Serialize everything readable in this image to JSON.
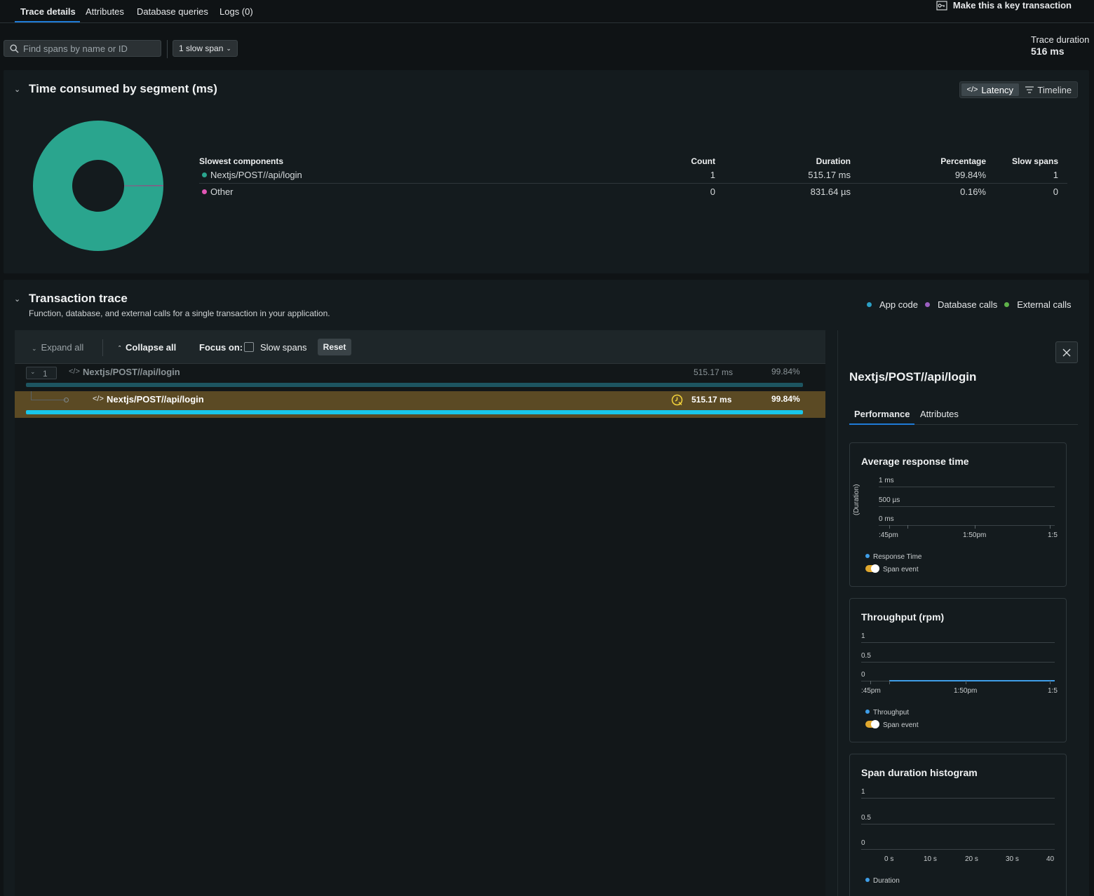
{
  "tabs": [
    {
      "label": "Trace details"
    },
    {
      "label": "Attributes"
    },
    {
      "label": "Database queries"
    },
    {
      "label": "Logs (0)"
    }
  ],
  "key_transaction_label": "Make this a key transaction",
  "search": {
    "placeholder": "Find spans by name or ID"
  },
  "slow_span_filter": "1 slow span",
  "trace_duration": {
    "label": "Trace duration",
    "value": "516 ms"
  },
  "segment": {
    "title": "Time consumed by segment (ms)",
    "toggle": {
      "latency": "Latency",
      "timeline": "Timeline"
    },
    "donut_percentages": [
      99.84,
      0.16
    ],
    "donut_colors": [
      "#2aa58e",
      "#cf4fae"
    ],
    "table": {
      "headers": {
        "component": "Slowest components",
        "count": "Count",
        "duration": "Duration",
        "percentage": "Percentage",
        "slow_spans": "Slow spans"
      },
      "rows": [
        {
          "name": "Nextjs/POST//api/login",
          "count": "1",
          "duration": "515.17 ms",
          "percentage": "99.84%",
          "slow_spans": "1",
          "color": "#2aa58e"
        },
        {
          "name": "Other",
          "count": "0",
          "duration": "831.64 µs",
          "percentage": "0.16%",
          "slow_spans": "0",
          "color": "#e056b4"
        }
      ]
    }
  },
  "transaction": {
    "title": "Transaction trace",
    "subtitle": "Function, database, and external calls for a single transaction in your application.",
    "legend": [
      {
        "label": "App code",
        "color": "#2b9fc4"
      },
      {
        "label": "Database calls",
        "color": "#9b5fc0"
      },
      {
        "label": "External calls",
        "color": "#5fb24a"
      }
    ],
    "toolbar": {
      "expand_all": "Expand all",
      "collapse_all": "Collapse all",
      "focus_on": "Focus on:",
      "slow_spans": "Slow spans",
      "reset": "Reset"
    },
    "rows": [
      {
        "count": "1",
        "name": "Nextjs/POST//api/login",
        "duration": "515.17 ms",
        "percentage": "99.84%"
      },
      {
        "name": "Nextjs/POST//api/login",
        "duration": "515.17 ms",
        "percentage": "99.84%"
      }
    ]
  },
  "side": {
    "title": "Nextjs/POST//api/login",
    "tabs": {
      "performance": "Performance",
      "attributes": "Attributes"
    },
    "avg_response": {
      "title": "Average response time",
      "y_label": "(Duration)",
      "y_ticks": [
        "1 ms",
        "500 µs",
        "0 ms"
      ],
      "x_ticks": [
        ":45pm",
        "1:50pm",
        "1:5"
      ],
      "legend": [
        "Response Time",
        "Span event"
      ]
    },
    "throughput": {
      "title": "Throughput (rpm)",
      "y_ticks": [
        "1",
        "0.5",
        "0"
      ],
      "x_ticks": [
        ":45pm",
        "1:50pm",
        "1:5"
      ],
      "legend": [
        "Throughput",
        "Span event"
      ]
    },
    "histogram": {
      "title": "Span duration histogram",
      "y_ticks": [
        "1",
        "0.5",
        "0"
      ],
      "x_ticks": [
        "0 s",
        "10 s",
        "20 s",
        "30 s",
        "40"
      ],
      "legend": [
        "Duration"
      ]
    }
  }
}
